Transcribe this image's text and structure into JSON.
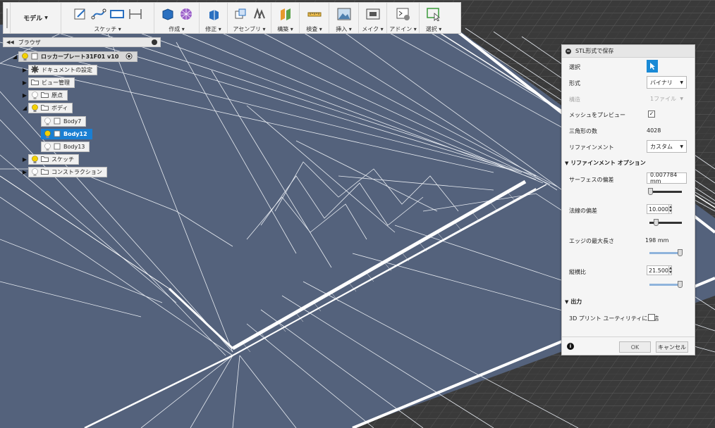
{
  "toolbar": {
    "mode_label": "モデル",
    "groups": [
      {
        "label": "スケッチ"
      },
      {
        "label": "作成"
      },
      {
        "label": "修正"
      },
      {
        "label": "アセンブリ"
      },
      {
        "label": "構築"
      },
      {
        "label": "検査"
      },
      {
        "label": "挿入"
      },
      {
        "label": "メイク"
      },
      {
        "label": "アドイン"
      },
      {
        "label": "選択"
      }
    ]
  },
  "browser": {
    "title": "ブラウザ",
    "items": [
      {
        "label": "ロッカープレート31F01 v10"
      },
      {
        "label": "ドキュメントの設定"
      },
      {
        "label": "ビュー管理"
      },
      {
        "label": "原点"
      },
      {
        "label": "ボディ"
      },
      {
        "label": "Body7"
      },
      {
        "label": "Body12"
      },
      {
        "label": "Body13"
      },
      {
        "label": "スケッチ"
      },
      {
        "label": "コンストラクション"
      }
    ]
  },
  "dialog": {
    "title": "STL形式で保存",
    "selection_label": "選択",
    "format_label": "形式",
    "format_value": "バイナリ",
    "structure_label": "構造",
    "structure_value": "1ファイル",
    "preview_label": "メッシュをプレビュー",
    "preview_checked": "✓",
    "triangle_label": "三角形の数",
    "triangle_value": "4028",
    "refinement_label": "リファインメント",
    "refinement_value": "カスタム",
    "refine_section": "リファインメント オプション",
    "surface_dev_label": "サーフェスの偏差",
    "surface_dev_value": "0.007784 mm",
    "normal_dev_label": "法線の偏差",
    "normal_dev_value": "10.000",
    "edge_len_label": "エッジの最大長さ",
    "edge_len_value": "198 mm",
    "aspect_label": "縦横比",
    "aspect_value": "21.500",
    "output_section": "出力",
    "send_3d_label": "3D プリント ユーティリティに送信",
    "ok_label": "OK",
    "cancel_label": "キャンセル",
    "info_label": "i"
  },
  "colors": {
    "viewport_bg": "#3a3a3a",
    "mesh_face": "#54627c",
    "accent": "#1a8ad6"
  }
}
